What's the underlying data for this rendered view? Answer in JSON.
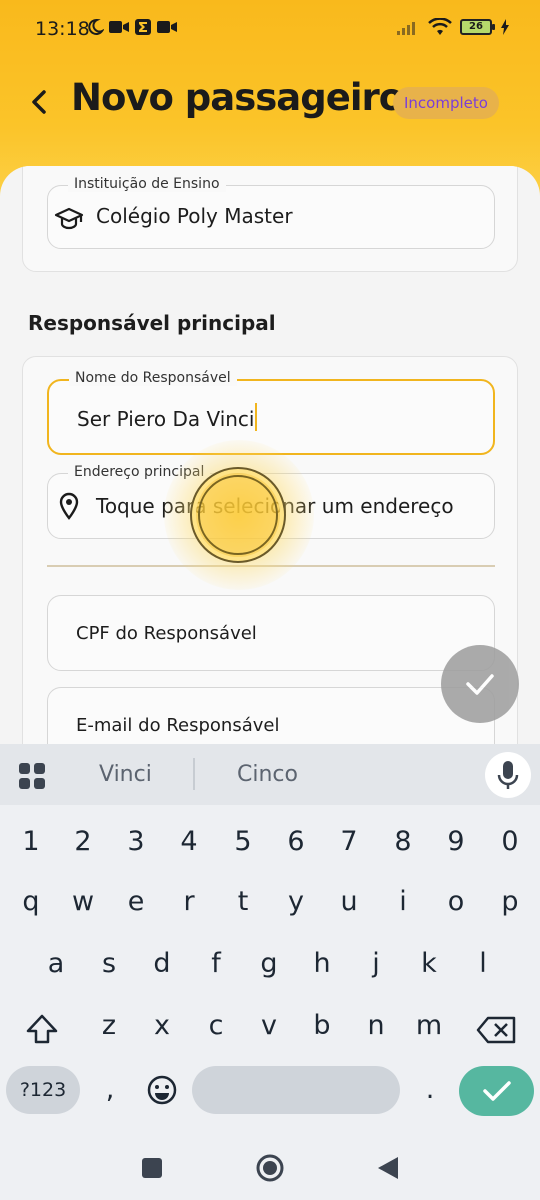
{
  "status_bar": {
    "time": "13:18",
    "battery": "26"
  },
  "header": {
    "title": "Novo passageiro",
    "badge": "Incompleto"
  },
  "form": {
    "institution": {
      "label": "Instituição de Ensino",
      "value": "Colégio Poly Master",
      "icon": "graduation-cap-icon"
    },
    "section_title": "Responsável principal",
    "guardian_name": {
      "label": "Nome do Responsável",
      "value": "Ser Piero Da Vinci"
    },
    "main_address": {
      "label": "Endereço principal",
      "placeholder": "Toque para selecionar um endereço",
      "icon": "location-pin-icon"
    },
    "cpf": {
      "placeholder": "CPF do Responsável"
    },
    "email": {
      "placeholder": "E-mail do Responsável"
    }
  },
  "keyboard": {
    "suggestions": [
      "Vinci",
      "Cinco"
    ],
    "number_row": [
      "1",
      "2",
      "3",
      "4",
      "5",
      "6",
      "7",
      "8",
      "9",
      "0"
    ],
    "row1": [
      "q",
      "w",
      "e",
      "r",
      "t",
      "y",
      "u",
      "i",
      "o",
      "p"
    ],
    "row2": [
      "a",
      "s",
      "d",
      "f",
      "g",
      "h",
      "j",
      "k",
      "l"
    ],
    "row3": [
      "z",
      "x",
      "c",
      "v",
      "b",
      "n",
      "m"
    ],
    "symbols_key": "?123",
    "comma": ",",
    "period": "."
  },
  "colors": {
    "accent": "#f1b51e",
    "badge_text": "#7b3fd8",
    "enter_key": "#56b7a0"
  }
}
